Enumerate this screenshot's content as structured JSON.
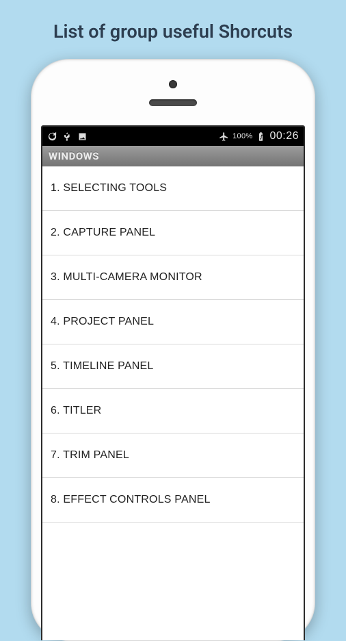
{
  "page_title": "List of group useful Shorcuts",
  "statusbar": {
    "battery_percent": "100%",
    "time": "00:26"
  },
  "section_header": "WINDOWS",
  "items": [
    "1. SELECTING TOOLS",
    "2. CAPTURE PANEL",
    "3. MULTI-CAMERA MONITOR",
    "4. PROJECT PANEL",
    "5. TIMELINE PANEL",
    "6. TITLER",
    "7. TRIM PANEL",
    "8. EFFECT CONTROLS PANEL"
  ]
}
